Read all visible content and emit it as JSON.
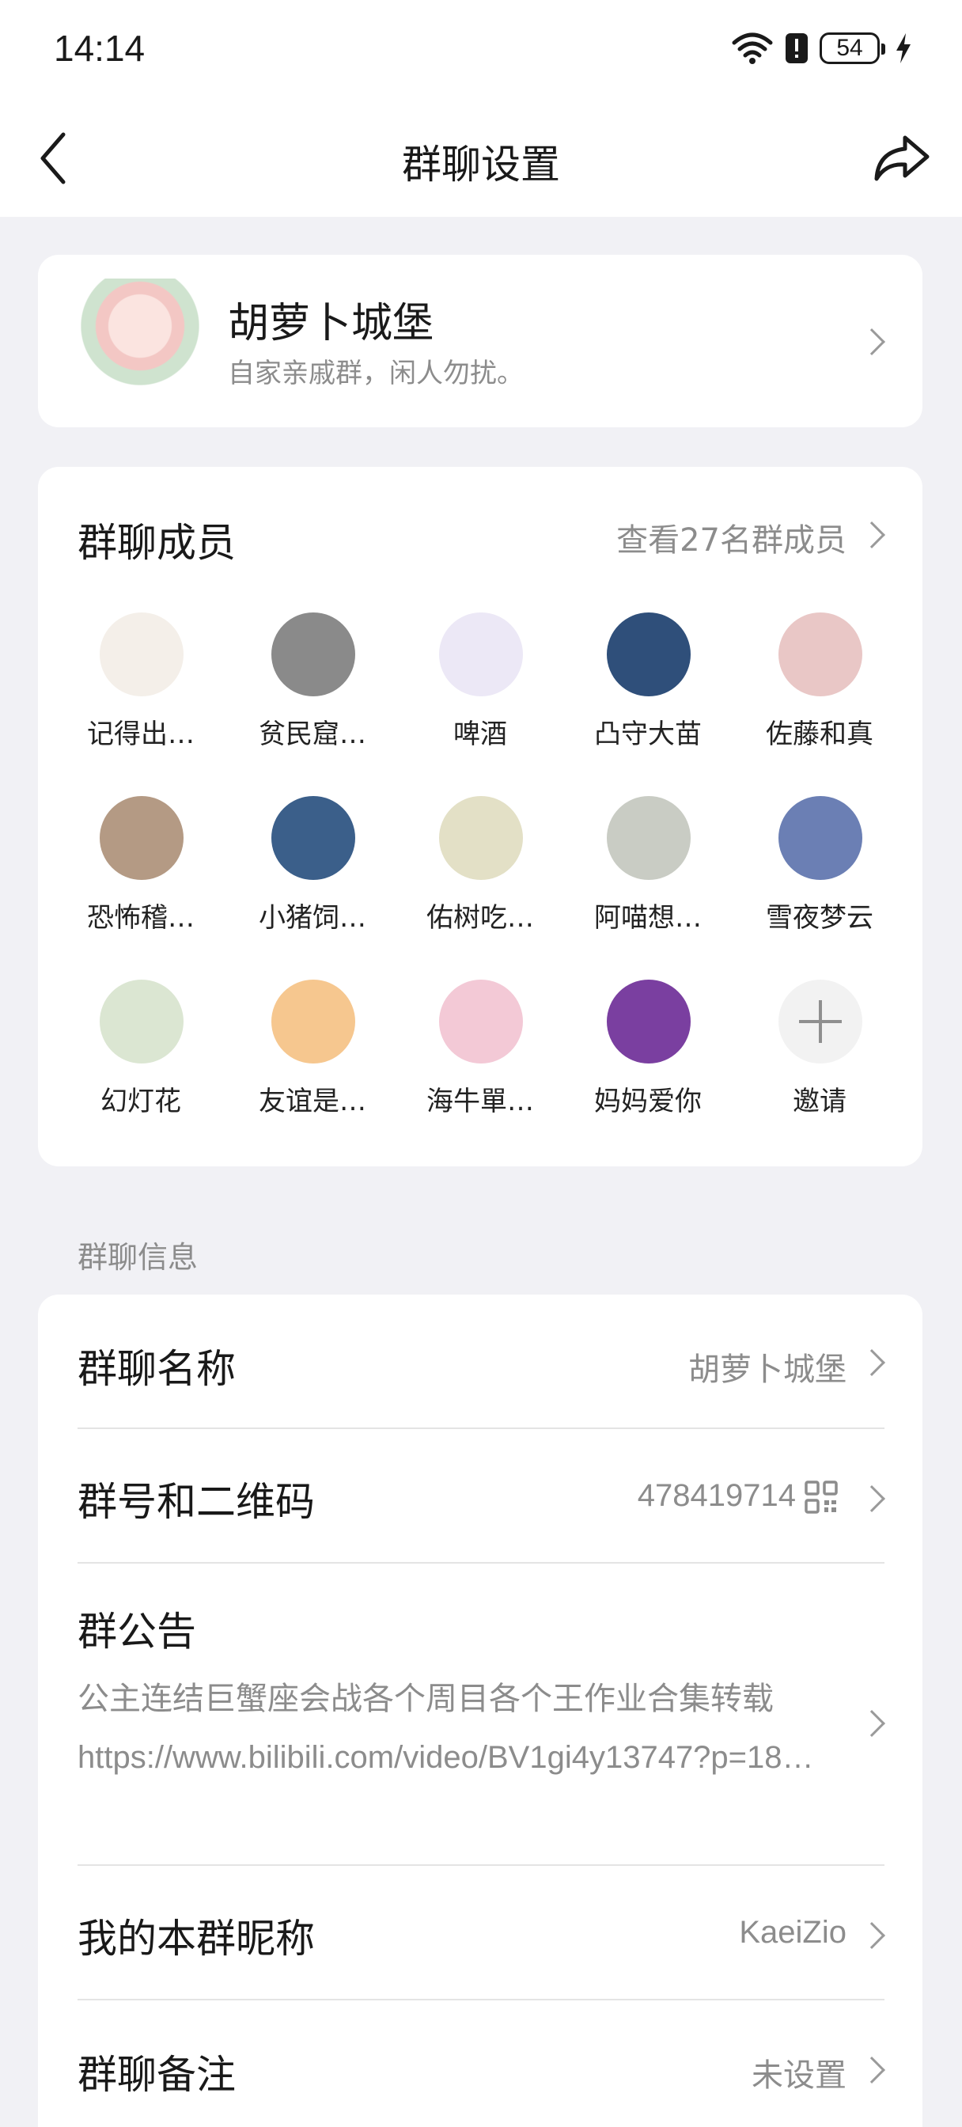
{
  "status_bar": {
    "time": "14:14",
    "battery": "54"
  },
  "nav": {
    "title": "群聊设置"
  },
  "group": {
    "name": "胡萝卜城堡",
    "description": "自家亲戚群，闲人勿扰。"
  },
  "members": {
    "title": "群聊成员",
    "view_all": "查看27名群成员",
    "list": [
      {
        "name": "记得出…",
        "color": "#f4efe9"
      },
      {
        "name": "贫民窟…",
        "color": "#8a8a8a"
      },
      {
        "name": "啤酒",
        "color": "#ece8f6"
      },
      {
        "name": "凸守大苗",
        "color": "#2f4f7a"
      },
      {
        "name": "佐藤和真",
        "color": "#e9c7c6"
      },
      {
        "name": "恐怖稽…",
        "color": "#b49a84"
      },
      {
        "name": "小猪饲…",
        "color": "#3b5f8a"
      },
      {
        "name": "佑树吃…",
        "color": "#e3e0c6"
      },
      {
        "name": "阿喵想…",
        "color": "#c9ccc4"
      },
      {
        "name": "雪夜梦云",
        "color": "#6b7fb4"
      },
      {
        "name": "幻灯花",
        "color": "#dbe6d2"
      },
      {
        "name": "友谊是…",
        "color": "#f6c78f"
      },
      {
        "name": "海牛單…",
        "color": "#f3c9d6"
      },
      {
        "name": "妈妈爱你",
        "color": "#7a3fa0"
      }
    ],
    "invite_label": "邀请"
  },
  "info": {
    "section_label": "群聊信息",
    "name_title": "群聊名称",
    "name_value": "胡萝卜城堡",
    "number_title": "群号和二维码",
    "number_value": "478419714",
    "announce_title": "群公告",
    "announce_text": "公主连结巨蟹座会战各个周目各个王作业合集转载 https://www.bilibili.com/video/BV1gi4y13747?p=18…",
    "nickname_title": "我的本群昵称",
    "nickname_value": "KaeiZio",
    "remark_title": "群聊备注",
    "remark_value": "未设置"
  }
}
